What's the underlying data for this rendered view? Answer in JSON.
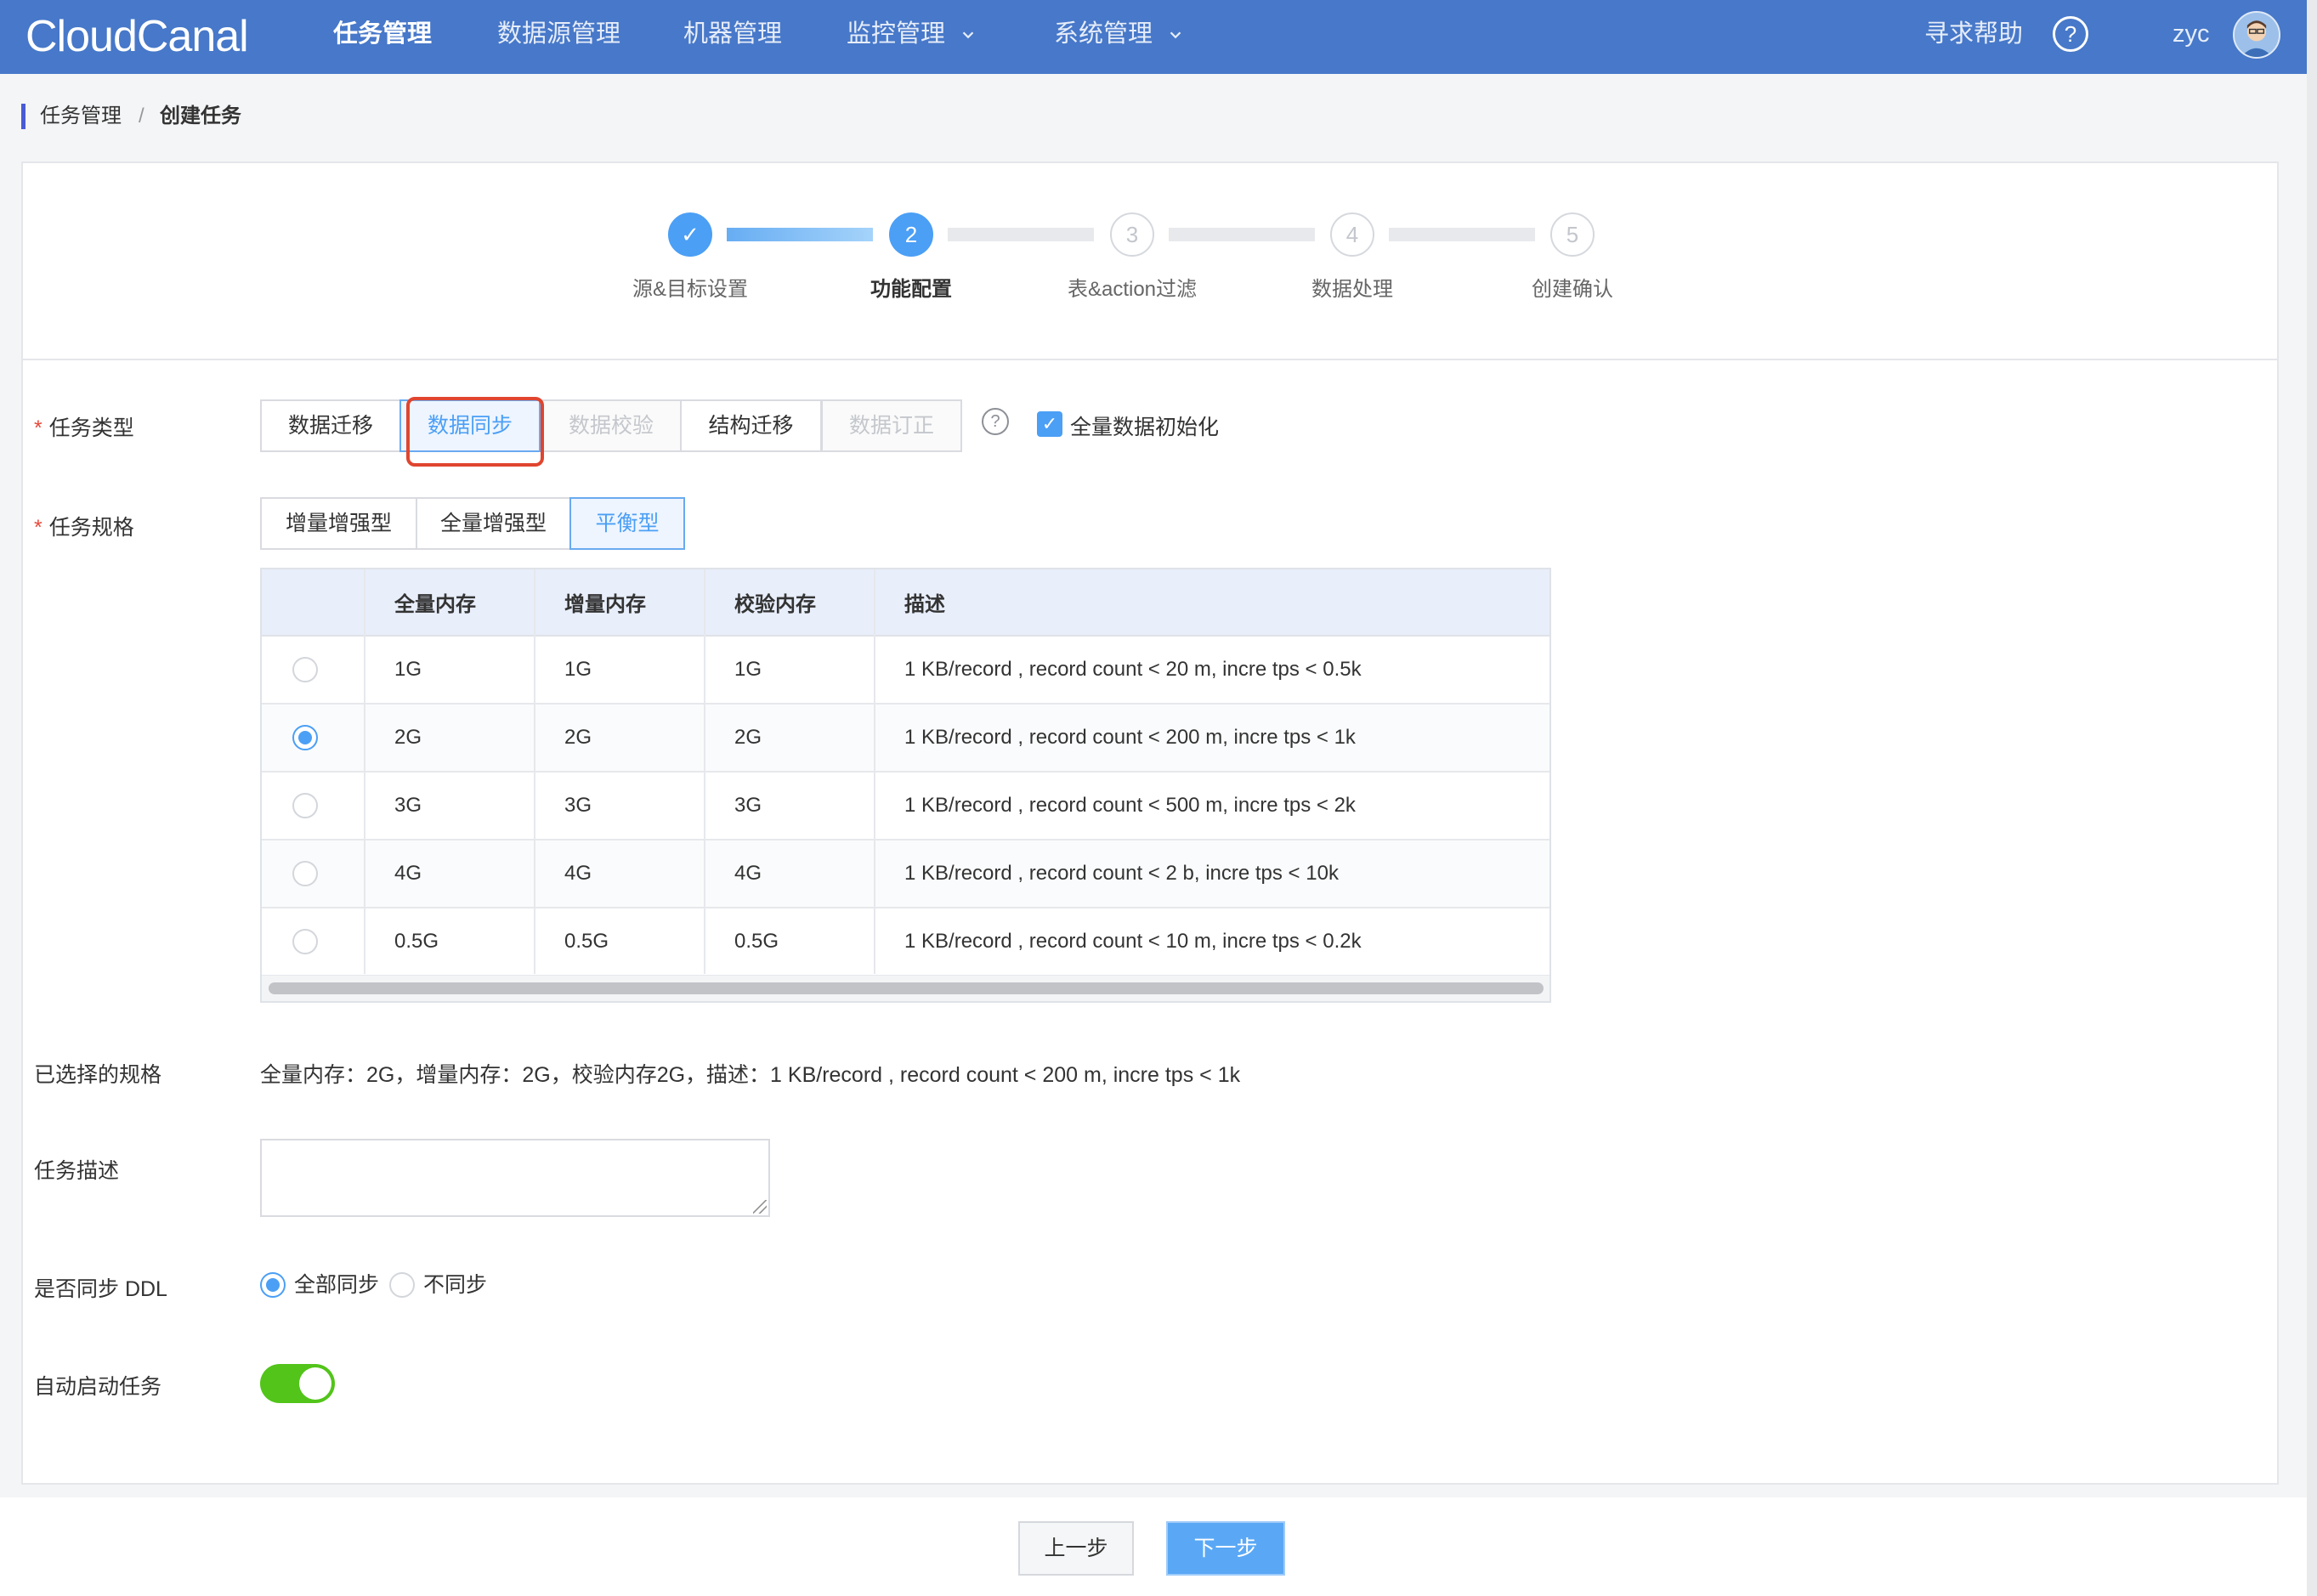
{
  "app": {
    "logo": "CloudCanal"
  },
  "nav": {
    "items": [
      {
        "label": "任务管理",
        "active": true,
        "has_dropdown": false
      },
      {
        "label": "数据源管理",
        "active": false,
        "has_dropdown": false
      },
      {
        "label": "机器管理",
        "active": false,
        "has_dropdown": false
      },
      {
        "label": "监控管理",
        "active": false,
        "has_dropdown": true
      },
      {
        "label": "系统管理",
        "active": false,
        "has_dropdown": true
      }
    ],
    "help_label": "寻求帮助",
    "help_icon": "?",
    "username": "zyc"
  },
  "breadcrumb": {
    "parent": "任务管理",
    "separator": "/",
    "current": "创建任务"
  },
  "steps": [
    {
      "num": "✓",
      "label": "源&目标设置",
      "state": "done"
    },
    {
      "num": "2",
      "label": "功能配置",
      "state": "current"
    },
    {
      "num": "3",
      "label": "表&action过滤",
      "state": "todo"
    },
    {
      "num": "4",
      "label": "数据处理",
      "state": "todo"
    },
    {
      "num": "5",
      "label": "创建确认",
      "state": "todo"
    }
  ],
  "form": {
    "required_mark": "*",
    "task_type": {
      "label": "任务类型",
      "options": [
        "数据迁移",
        "数据同步",
        "数据校验",
        "结构迁移",
        "数据订正"
      ],
      "selected": "数据同步",
      "disabled": [
        "数据校验",
        "数据订正"
      ],
      "help_icon": "?",
      "full_init_checked": true,
      "full_init_label": "全量数据初始化",
      "check_mark": "✓"
    },
    "task_spec": {
      "label": "任务规格",
      "options": [
        "增量增强型",
        "全量增强型",
        "平衡型"
      ],
      "selected": "平衡型"
    },
    "spec_table": {
      "headers": [
        "全量内存",
        "增量内存",
        "校验内存",
        "描述"
      ],
      "rows": [
        {
          "full": "1G",
          "incr": "1G",
          "check": "1G",
          "desc": "1 KB/record , record count < 20 m, incre tps < 0.5k",
          "selected": false
        },
        {
          "full": "2G",
          "incr": "2G",
          "check": "2G",
          "desc": "1 KB/record , record count < 200 m, incre tps < 1k",
          "selected": true
        },
        {
          "full": "3G",
          "incr": "3G",
          "check": "3G",
          "desc": "1 KB/record , record count < 500 m, incre tps < 2k",
          "selected": false
        },
        {
          "full": "4G",
          "incr": "4G",
          "check": "4G",
          "desc": "1 KB/record , record count < 2 b, incre tps < 10k",
          "selected": false
        },
        {
          "full": "0.5G",
          "incr": "0.5G",
          "check": "0.5G",
          "desc": "1 KB/record , record count < 10 m, incre tps < 0.2k",
          "selected": false
        }
      ]
    },
    "selected_spec": {
      "label": "已选择的规格",
      "value": "全量内存：2G，增量内存：2G，校验内存2G，描述：1 KB/record , record count < 200 m, incre tps < 1k"
    },
    "task_desc": {
      "label": "任务描述",
      "value": ""
    },
    "ddl_sync": {
      "label": "是否同步 DDL",
      "options": [
        "全部同步",
        "不同步"
      ],
      "selected": "全部同步"
    },
    "auto_start": {
      "label": "自动启动任务",
      "enabled": true
    }
  },
  "footer": {
    "prev_label": "上一步",
    "next_label": "下一步"
  },
  "colors": {
    "nav_bg": "#4778c9",
    "primary": "#4b9ff5",
    "highlight": "#e0452f",
    "toggle_on": "#52c41a"
  }
}
